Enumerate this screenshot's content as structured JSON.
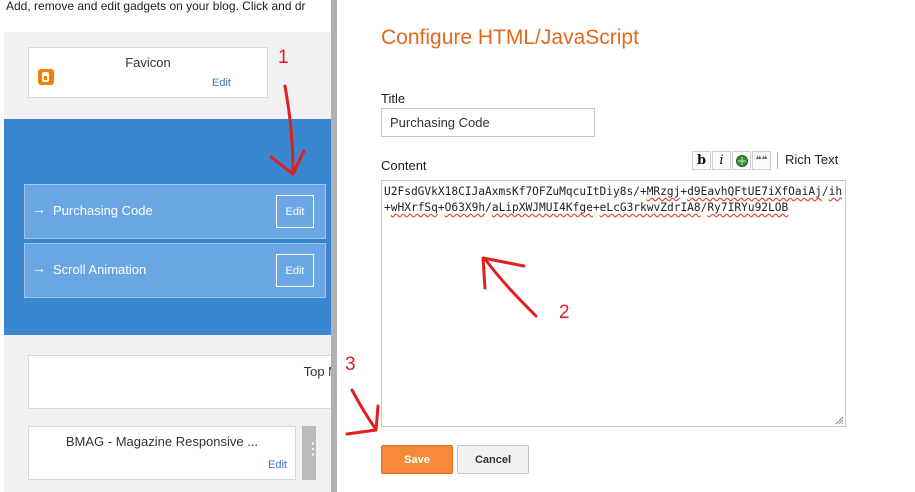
{
  "background": {
    "description": "Add, remove and edit gadgets on your blog. Click and dr",
    "favicon_gadget": {
      "title": "Favicon",
      "edit_label": "Edit"
    },
    "blue_items": [
      {
        "label": "Purchasing Code",
        "edit_label": "Edit"
      },
      {
        "label": "Scroll Animation",
        "edit_label": "Edit"
      }
    ],
    "top_gadget": {
      "title": "Top M"
    },
    "bmag_gadget": {
      "title": "BMAG - Magazine Responsive ...",
      "edit_label": "Edit"
    },
    "arrow_glyph": "→"
  },
  "dialog": {
    "title": "Configure HTML/JavaScript",
    "title_label": "Title",
    "title_value": "Purchasing Code",
    "content_label": "Content",
    "content_plain_a": "U2FsdGVkX18CIJaAxmsKf7OFZuMqcuItDiy8s/+",
    "content_spell_a": "MRzgj",
    "content_plain_b": "+",
    "content_spell_b": "d9EavhQFtUE7iXfOaiAj",
    "content_plain_c": "/",
    "content_spell_c": "ih",
    "content_plain_d": "+",
    "content_spell_d": "wHXrfSq",
    "content_plain_e": "+",
    "content_spell_e": "O63X9h",
    "content_plain_f": "/",
    "content_spell_f": "aLipXWJMUI4Kfge",
    "content_plain_g": "+",
    "content_spell_g": "eLcG3rkwvZdrIA8",
    "content_plain_h": "/",
    "content_spell_h": "Ry7IRYu92LOB",
    "toolbar": {
      "bold": "b",
      "italic": "i",
      "quote": "❝❝",
      "rich_text": "Rich Text"
    },
    "save_label": "Save",
    "cancel_label": "Cancel"
  },
  "annotations": {
    "one": "1",
    "two": "2",
    "three": "3"
  },
  "colors": {
    "accent_orange": "#e06a1c",
    "save_orange": "#f68a3a",
    "layout_blue": "#3a87d0",
    "annotation_red": "#e02020"
  }
}
